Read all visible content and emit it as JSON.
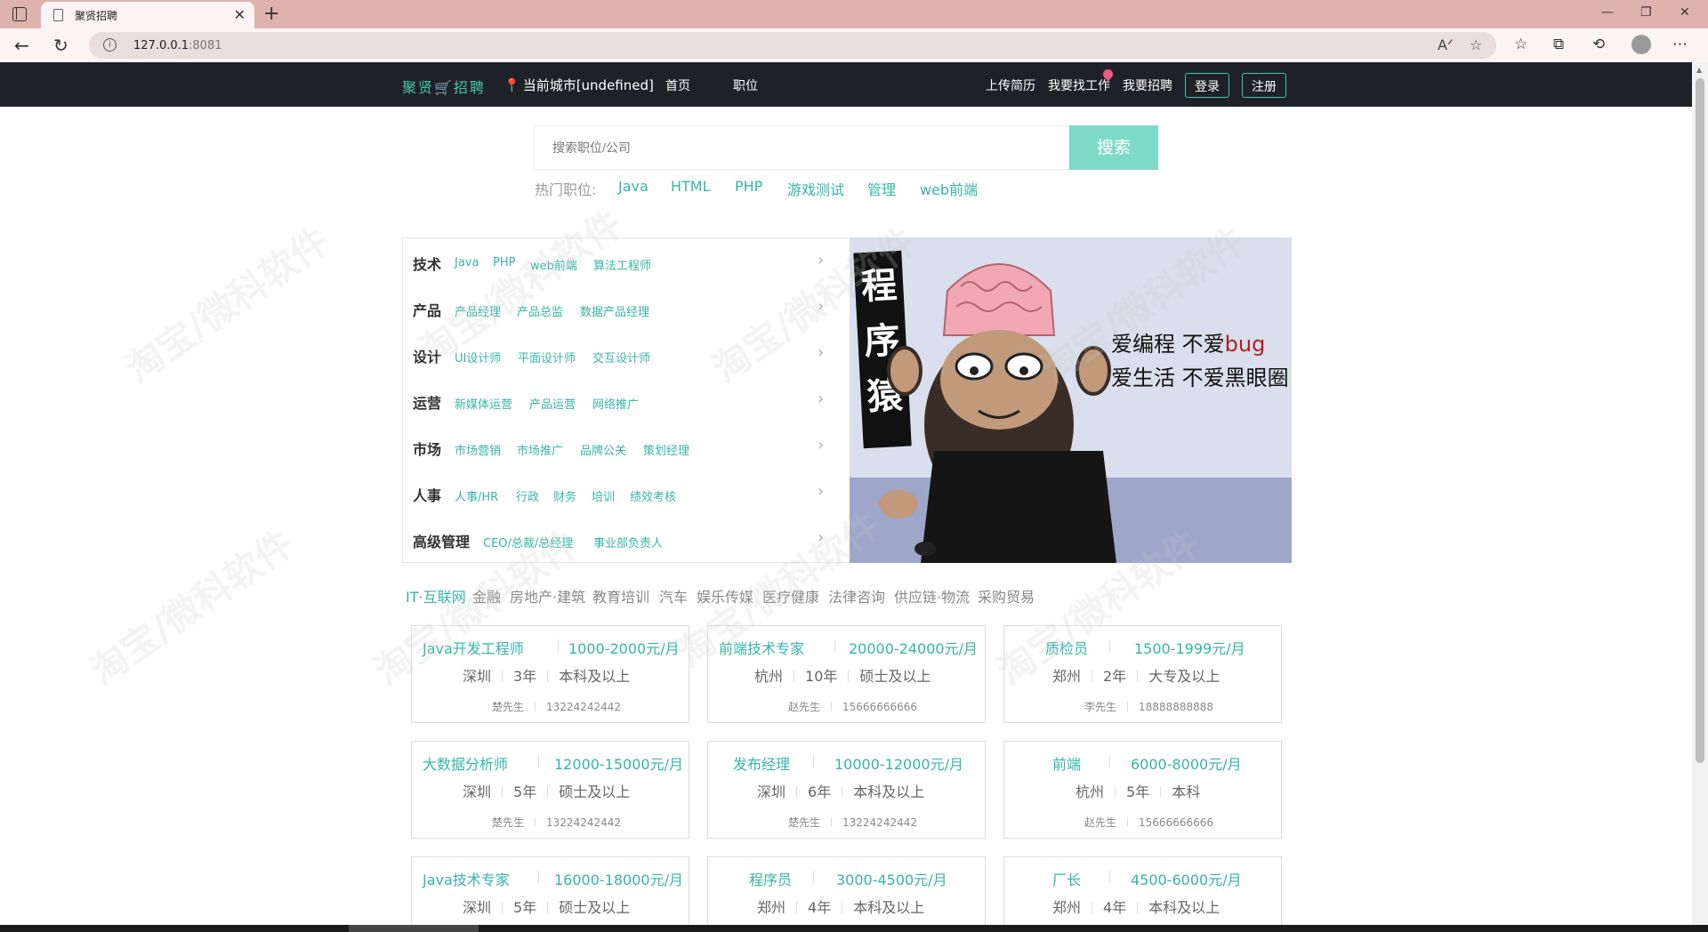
{
  "browser": {
    "tab_title": "聚贤招聘",
    "url_host": "127.0.0.1",
    "url_port": ":8081"
  },
  "header": {
    "logo": "聚贤🛒招聘",
    "city": "当前城市[undefined]",
    "nav": [
      "首页",
      "职位"
    ],
    "links": [
      "上传简历",
      "我要找工作",
      "我要招聘"
    ],
    "login": "登录",
    "register": "注册"
  },
  "search": {
    "placeholder": "搜索职位/公司",
    "button": "搜索",
    "hot_label": "热门职位:",
    "hot_items": [
      "Java",
      "HTML",
      "PHP",
      "游戏测试",
      "管理",
      "web前端"
    ]
  },
  "categories": [
    {
      "title": "技术",
      "tags": [
        "Java",
        "PHP",
        "web前端",
        "算法工程师"
      ]
    },
    {
      "title": "产品",
      "tags": [
        "产品经理",
        "产品总监",
        "数据产品经理"
      ]
    },
    {
      "title": "设计",
      "tags": [
        "UI设计师",
        "平面设计师",
        "交互设计师"
      ]
    },
    {
      "title": "运营",
      "tags": [
        "新媒体运营",
        "产品运营",
        "网络推广"
      ]
    },
    {
      "title": "市场",
      "tags": [
        "市场营销",
        "市场推广",
        "品牌公关",
        "策划经理"
      ]
    },
    {
      "title": "人事",
      "tags": [
        "人事/HR",
        "行政",
        "财务",
        "培训",
        "绩效考核"
      ]
    },
    {
      "title": "高级管理",
      "tags": [
        "CEO/总裁/总经理",
        "事业部负责人"
      ]
    }
  ],
  "banner": {
    "vertical_text": "程序猿",
    "line1_a": "爱编程 不爱",
    "line1_b": "bug",
    "line2": "爱生活 不爱黑眼圈"
  },
  "industries": [
    "IT·互联网",
    "金融",
    "房地产·建筑",
    "教育培训",
    "汽车",
    "娱乐传媒",
    "医疗健康",
    "法律咨询",
    "供应链·物流",
    "采购贸易"
  ],
  "jobs": [
    {
      "title": "Java开发工程师",
      "salary": "1000-2000元/月",
      "city": "深圳",
      "exp": "3年",
      "edu": "本科及以上",
      "contact": "楚先生",
      "phone": "13224242442"
    },
    {
      "title": "前端技术专家",
      "salary": "20000-24000元/月",
      "city": "杭州",
      "exp": "10年",
      "edu": "硕士及以上",
      "contact": "赵先生",
      "phone": "15666666666"
    },
    {
      "title": "质检员",
      "salary": "1500-1999元/月",
      "city": "郑州",
      "exp": "2年",
      "edu": "大专及以上",
      "contact": "李先生",
      "phone": "18888888888"
    },
    {
      "title": "大数据分析师",
      "salary": "12000-15000元/月",
      "city": "深圳",
      "exp": "5年",
      "edu": "硕士及以上",
      "contact": "楚先生",
      "phone": "13224242442"
    },
    {
      "title": "发布经理",
      "salary": "10000-12000元/月",
      "city": "深圳",
      "exp": "6年",
      "edu": "本科及以上",
      "contact": "楚先生",
      "phone": "13224242442"
    },
    {
      "title": "前端",
      "salary": "6000-8000元/月",
      "city": "杭州",
      "exp": "5年",
      "edu": "本科",
      "contact": "赵先生",
      "phone": "15666666666"
    },
    {
      "title": "Java技术专家",
      "salary": "16000-18000元/月",
      "city": "深圳",
      "exp": "5年",
      "edu": "硕士及以上",
      "contact": "",
      "phone": ""
    },
    {
      "title": "程序员",
      "salary": "3000-4500元/月",
      "city": "郑州",
      "exp": "4年",
      "edu": "本科及以上",
      "contact": "",
      "phone": ""
    },
    {
      "title": "厂长",
      "salary": "4500-6000元/月",
      "city": "郑州",
      "exp": "4年",
      "edu": "本科及以上",
      "contact": "",
      "phone": ""
    }
  ],
  "watermark": "淘宝/微科软件",
  "colors": {
    "accent": "#36b5a6",
    "header_bg": "#1f2128",
    "search_btn": "#7fd9c9",
    "tabbar": "#deb3ad"
  }
}
